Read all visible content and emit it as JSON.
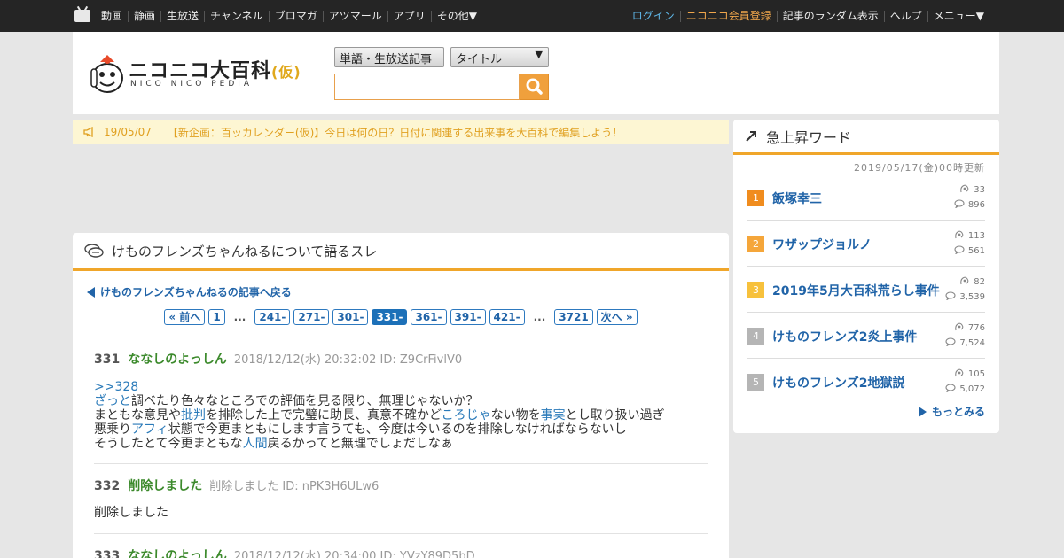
{
  "topnav": {
    "left": [
      "動画",
      "静画",
      "生放送",
      "チャンネル",
      "ブロマガ",
      "アツマール",
      "アプリ",
      "その他▼"
    ],
    "login": "ログイン",
    "register": "ニコニコ会員登録",
    "right": [
      "記事のランダム表示",
      "ヘルプ",
      "メニュー▼"
    ]
  },
  "header": {
    "logo_text": "ニコニコ大百科",
    "logo_kari": "(仮)",
    "logo_sub": "NICO NICO PEDIA",
    "select_type": "単語・生放送記事",
    "select_field": "タイトル",
    "search_value": ""
  },
  "announcement": {
    "date": "19/05/07",
    "text": "【新企画：百ッカレンダー(仮)】今日は何の日？日付に関連する出来事を大百科で編集しよう！"
  },
  "thread": {
    "title": "けものフレンズちゃんねるについて語るスレ",
    "back_link": "けものフレンズちゃんねるの記事へ戻る",
    "pager": {
      "prev": "« 前へ",
      "first": "1",
      "dots": "...",
      "pages": [
        "241-",
        "271-",
        "301-",
        "331-",
        "361-",
        "391-",
        "421-"
      ],
      "current": "331-",
      "last": "3721",
      "next": "次へ »"
    },
    "posts": [
      {
        "num": "331",
        "name": "ななしのよっしん",
        "meta": "2018/12/12(水) 20:32:02 ID: Z9CrFivlV0",
        "anchor": ">>328",
        "line1_link": "ざっと",
        "line1_rest": "調べたり色々なところでの評価を見る限り、無理じゃないか？",
        "line2_a": "まともな意見や",
        "line2_link1": "批判",
        "line2_b": "を排除した上で完璧に助長、真意不確かど",
        "line2_link2": "ころじゃ",
        "line2_c": "ない物を",
        "line2_link3": "事実",
        "line2_d": "とし取り扱い過ぎ",
        "line3_a": "悪乗り",
        "line3_link": "アフィ",
        "line3_b": "状態で今更まともにします言うても、今度は今いるのを排除しなければならないし",
        "line4_a": "そうしたとて今更まともな",
        "line4_link": "人間",
        "line4_b": "戻るかってと無理でしょだしなぁ"
      },
      {
        "num": "332",
        "name": "削除しました",
        "meta": "削除しました ID: nPK3H6ULw6",
        "body": "削除しました"
      },
      {
        "num": "333",
        "name": "ななしのよっしん",
        "meta": "2018/12/12(水) 20:34:00 ID: YVzY89D5bD"
      }
    ]
  },
  "sidebar": {
    "title": "急上昇ワード",
    "updated": "2019/05/17(金)00時更新",
    "ranks": [
      {
        "rank": "1",
        "word": "飯塚幸三",
        "views": "33",
        "comments": "896",
        "color": "#f08c1e"
      },
      {
        "rank": "2",
        "word": "ワザップジョルノ",
        "views": "113",
        "comments": "561",
        "color": "#f5a63a"
      },
      {
        "rank": "3",
        "word": "2019年5月大百科荒らし事件",
        "views": "82",
        "comments": "3,539",
        "color": "#f7c13c"
      },
      {
        "rank": "4",
        "word": "けものフレンズ2炎上事件",
        "views": "776",
        "comments": "7,524",
        "color": "#b5b5b5"
      },
      {
        "rank": "5",
        "word": "けものフレンズ2地獄説",
        "views": "105",
        "comments": "5,072",
        "color": "#b5b5b5"
      }
    ],
    "more": "もっとみる"
  }
}
